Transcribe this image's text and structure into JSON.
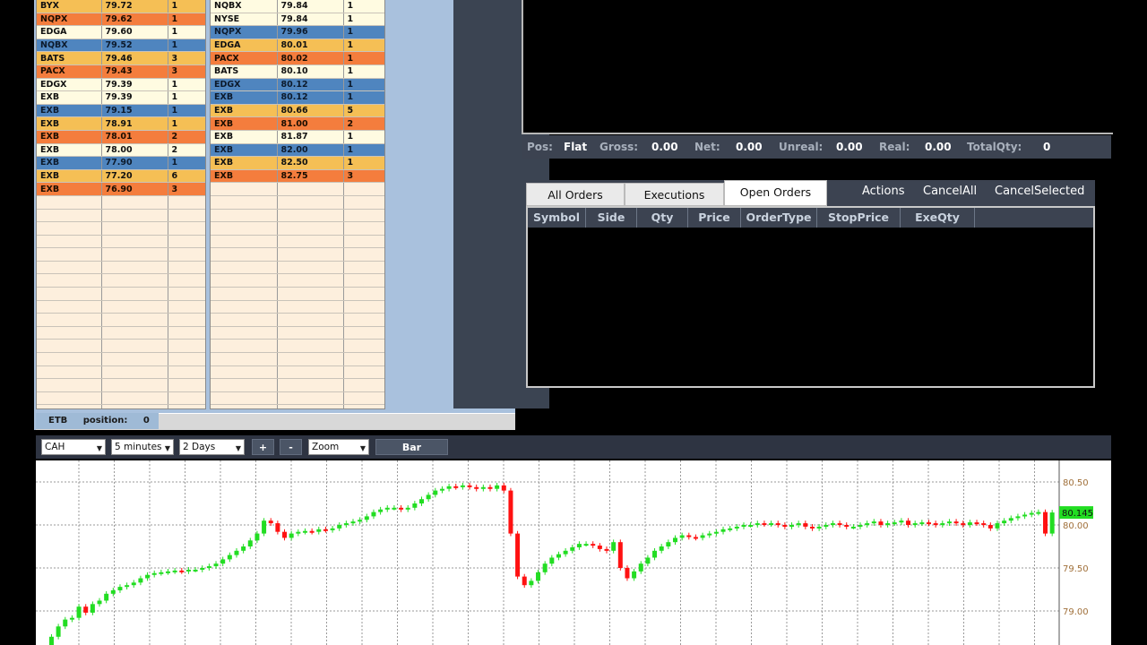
{
  "level2": {
    "bid_rows": [
      {
        "venue": "BYX",
        "price": "79.72",
        "size": "1",
        "color": "yellow"
      },
      {
        "venue": "NQPX",
        "price": "79.62",
        "size": "1",
        "color": "orange"
      },
      {
        "venue": "EDGA",
        "price": "79.60",
        "size": "1",
        "color": "cream"
      },
      {
        "venue": "NQBX",
        "price": "79.52",
        "size": "1",
        "color": "blue"
      },
      {
        "venue": "BATS",
        "price": "79.46",
        "size": "3",
        "color": "yellow"
      },
      {
        "venue": "PACX",
        "price": "79.43",
        "size": "3",
        "color": "orange"
      },
      {
        "venue": "EDGX",
        "price": "79.39",
        "size": "1",
        "color": "cream"
      },
      {
        "venue": "EXB",
        "price": "79.39",
        "size": "1",
        "color": "cream"
      },
      {
        "venue": "EXB",
        "price": "79.15",
        "size": "1",
        "color": "blue"
      },
      {
        "venue": "EXB",
        "price": "78.91",
        "size": "1",
        "color": "yellow"
      },
      {
        "venue": "EXB",
        "price": "78.01",
        "size": "2",
        "color": "orange"
      },
      {
        "venue": "EXB",
        "price": "78.00",
        "size": "2",
        "color": "cream"
      },
      {
        "venue": "EXB",
        "price": "77.90",
        "size": "1",
        "color": "blue"
      },
      {
        "venue": "EXB",
        "price": "77.20",
        "size": "6",
        "color": "yellow"
      },
      {
        "venue": "EXB",
        "price": "76.90",
        "size": "3",
        "color": "orange"
      }
    ],
    "ask_rows": [
      {
        "venue": "NQBX",
        "price": "79.84",
        "size": "1",
        "color": "cream"
      },
      {
        "venue": "NYSE",
        "price": "79.84",
        "size": "1",
        "color": "cream"
      },
      {
        "venue": "NQPX",
        "price": "79.96",
        "size": "1",
        "color": "blue"
      },
      {
        "venue": "EDGA",
        "price": "80.01",
        "size": "1",
        "color": "yellow"
      },
      {
        "venue": "PACX",
        "price": "80.02",
        "size": "1",
        "color": "orange"
      },
      {
        "venue": "BATS",
        "price": "80.10",
        "size": "1",
        "color": "cream"
      },
      {
        "venue": "EDGX",
        "price": "80.12",
        "size": "1",
        "color": "blue"
      },
      {
        "venue": "EXB",
        "price": "80.12",
        "size": "1",
        "color": "blue"
      },
      {
        "venue": "EXB",
        "price": "80.66",
        "size": "5",
        "color": "yellow"
      },
      {
        "venue": "EXB",
        "price": "81.00",
        "size": "2",
        "color": "orange"
      },
      {
        "venue": "EXB",
        "price": "81.87",
        "size": "1",
        "color": "cream"
      },
      {
        "venue": "EXB",
        "price": "82.00",
        "size": "1",
        "color": "blue"
      },
      {
        "venue": "EXB",
        "price": "82.50",
        "size": "1",
        "color": "yellow"
      },
      {
        "venue": "EXB",
        "price": "82.75",
        "size": "3",
        "color": "orange"
      }
    ],
    "empty_rows": 18,
    "status": {
      "symbol": "ETB",
      "position_label": "position:",
      "position_value": "0"
    }
  },
  "position_bar": {
    "pos_label": "Pos:",
    "pos_value": "Flat",
    "gross_label": "Gross:",
    "gross_value": "0.00",
    "net_label": "Net:",
    "net_value": "0.00",
    "unreal_label": "Unreal:",
    "unreal_value": "0.00",
    "real_label": "Real:",
    "real_value": "0.00",
    "totalqty_label": "TotalQty:",
    "totalqty_value": "0"
  },
  "orders": {
    "tabs": [
      "All Orders",
      "Executions",
      "Open Orders"
    ],
    "active_tab": "Open Orders",
    "actions": [
      "Actions",
      "CancelAll",
      "CancelSelected"
    ],
    "columns": [
      "Symbol",
      "Side",
      "Qty",
      "Price",
      "OrderType",
      "StopPrice",
      "ExeQty"
    ]
  },
  "chart_toolbar": {
    "symbol": "CAH",
    "interval": "5 minutes",
    "range": "2 Days",
    "zoom_in": "+",
    "zoom_out": "-",
    "zoom": "Zoom",
    "style": "Bar"
  },
  "chart_data": {
    "type": "candlestick",
    "y_ticks": [
      "80.50",
      "80.00",
      "79.50",
      "79.00"
    ],
    "last_price": "80.145",
    "up_color": "#22dd22",
    "down_color": "#ff1111",
    "ylim": [
      78.6,
      80.55
    ],
    "closes": [
      78.55,
      78.7,
      78.82,
      78.9,
      78.92,
      79.05,
      78.98,
      79.08,
      79.12,
      79.2,
      79.24,
      79.28,
      79.3,
      79.33,
      79.38,
      79.42,
      79.44,
      79.45,
      79.46,
      79.47,
      79.46,
      79.48,
      79.48,
      79.5,
      79.52,
      79.55,
      79.6,
      79.65,
      79.7,
      79.75,
      79.82,
      79.9,
      80.05,
      80.02,
      79.92,
      79.85,
      79.9,
      79.92,
      79.93,
      79.92,
      79.95,
      79.94,
      79.96,
      80.0,
      80.02,
      80.04,
      80.06,
      80.1,
      80.15,
      80.18,
      80.2,
      80.2,
      80.18,
      80.2,
      80.25,
      80.3,
      80.35,
      80.4,
      80.42,
      80.45,
      80.44,
      80.46,
      80.44,
      80.42,
      80.44,
      80.42,
      80.46,
      80.4,
      79.9,
      79.4,
      79.3,
      79.35,
      79.45,
      79.55,
      79.62,
      79.66,
      79.7,
      79.74,
      79.78,
      79.78,
      79.76,
      79.72,
      79.7,
      79.8,
      79.5,
      79.38,
      79.46,
      79.55,
      79.62,
      79.7,
      79.75,
      79.8,
      79.85,
      79.88,
      79.86,
      79.85,
      79.88,
      79.9,
      79.92,
      79.95,
      79.96,
      79.98,
      80.0,
      80.0,
      80.02,
      80.01,
      80.02,
      80.0,
      79.98,
      80.0,
      80.02,
      79.98,
      79.96,
      79.98,
      80.0,
      80.02,
      80.0,
      79.98,
      79.98,
      80.0,
      80.02,
      80.04,
      80.0,
      80.02,
      80.03,
      80.05,
      80.0,
      80.02,
      80.03,
      80.02,
      80.0,
      80.02,
      80.04,
      80.02,
      80.0,
      80.03,
      80.02,
      80.0,
      79.96,
      80.02,
      80.05,
      80.08,
      80.1,
      80.12,
      80.14,
      80.15,
      79.9,
      80.145
    ]
  }
}
